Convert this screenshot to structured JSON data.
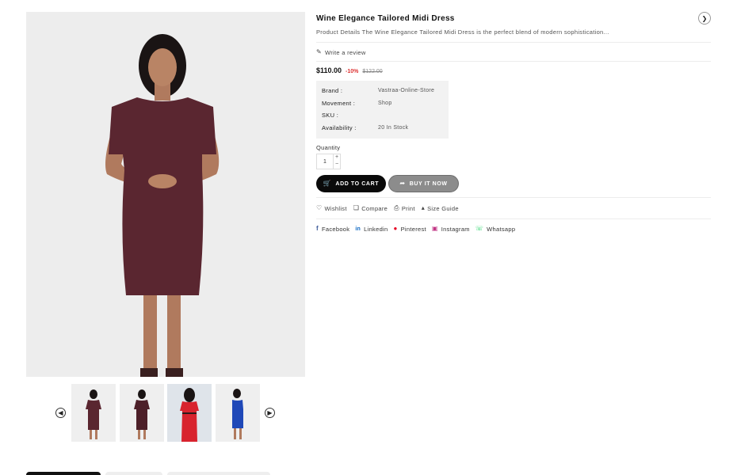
{
  "product": {
    "title": "Wine Elegance Tailored Midi Dress",
    "description": "Product Details The Wine Elegance Tailored Midi Dress is the perfect blend of modern sophistication...",
    "review_link": "Write a review",
    "price": "$110.00",
    "discount": "-10%",
    "old_price": "$122.00"
  },
  "specs": [
    {
      "label": "Brand :",
      "value": "Vastraa-Online-Store"
    },
    {
      "label": "Movement :",
      "value": "Shop"
    },
    {
      "label": "SKU :",
      "value": ""
    },
    {
      "label": "Availability :",
      "value": "20 In Stock"
    }
  ],
  "quantity": {
    "label": "Quantity",
    "value": "1",
    "plus": "+",
    "minus": "−"
  },
  "actions": {
    "add_to_cart": "ADD TO CART",
    "buy_now": "BUY IT NOW"
  },
  "utility": {
    "wishlist": "Wishlist",
    "compare": "Compare",
    "print": "Print",
    "size_guide": "Size Guide"
  },
  "social": {
    "facebook": "Facebook",
    "linkedin": "Linkedin",
    "pinterest": "Pinterest",
    "instagram": "Instagram",
    "whatsapp": "Whatsapp"
  },
  "icons": {
    "next": "chevron-right-icon",
    "prev": "chevron-left-icon",
    "review": "pencil-icon",
    "cart": "cart-icon",
    "buy": "share-arrow-icon"
  },
  "colors": {
    "dress_wine": "#5a2630",
    "discount_red": "#d33333",
    "cart_button": "#0a0a0a",
    "buy_button": "#8c8c8c",
    "facebook": "#3b5998",
    "linkedin": "#0a66c2",
    "pinterest": "#e60023",
    "instagram": "#c13584",
    "whatsapp": "#25d366"
  }
}
